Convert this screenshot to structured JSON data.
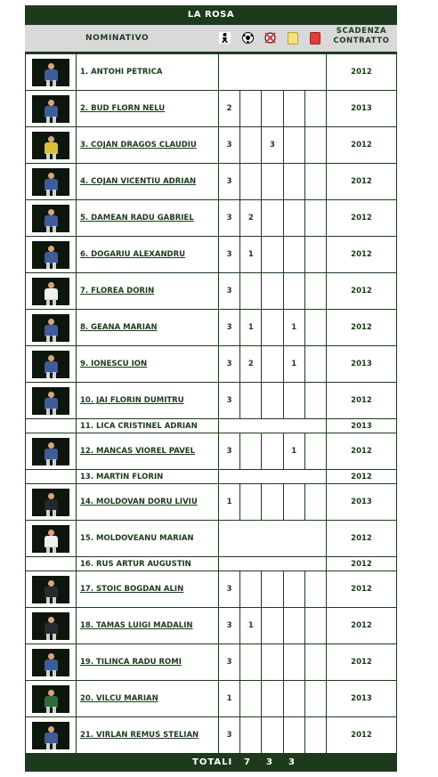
{
  "title": "LA ROSA",
  "header": {
    "nominativo": "NOMINATIVO",
    "scadenza_line1": "SCADENZA",
    "scadenza_line2": "CONTRATTO",
    "icons": [
      "presenze-icon",
      "gol-icon",
      "autogol-icon",
      "yellow-card-icon",
      "red-card-icon"
    ]
  },
  "colors": {
    "dark_green": "#1d3a1d",
    "header_gray": "#d9d9d9",
    "yellow_card": "#f5e27a",
    "red_card": "#e23b3b"
  },
  "players": [
    {
      "name": "1. ANTOHI PETRICA",
      "stats": [
        "",
        "",
        "",
        "",
        ""
      ],
      "year": "2012",
      "photo": true,
      "merged": true,
      "jersey": "#3e5b9a"
    },
    {
      "name": "2. BUD FLORN NELU",
      "stats": [
        "2",
        "",
        "",
        "",
        ""
      ],
      "year": "2013",
      "photo": true,
      "merged": false,
      "jersey": "#3e5b9a"
    },
    {
      "name": "3. COJAN DRAGOS CLAUDIU",
      "stats": [
        "3",
        "",
        "3",
        "",
        ""
      ],
      "year": "2012",
      "photo": true,
      "merged": false,
      "jersey": "#d9c23a"
    },
    {
      "name": "4. COJAN VICENTIU ADRIAN",
      "stats": [
        "3",
        "",
        "",
        "",
        ""
      ],
      "year": "2012",
      "photo": true,
      "merged": false,
      "jersey": "#3e5b9a"
    },
    {
      "name": "5. DAMEAN RADU GABRIEL",
      "stats": [
        "3",
        "2",
        "",
        "",
        ""
      ],
      "year": "2012",
      "photo": true,
      "merged": false,
      "jersey": "#3e5b9a"
    },
    {
      "name": "6. DOGARIU ALEXANDRU",
      "stats": [
        "3",
        "1",
        "",
        "",
        ""
      ],
      "year": "2012",
      "photo": true,
      "merged": false,
      "jersey": "#3e5b9a"
    },
    {
      "name": "7. FLOREA DORIN",
      "stats": [
        "3",
        "",
        "",
        "",
        ""
      ],
      "year": "2012",
      "photo": true,
      "merged": false,
      "jersey": "#f0f0f0"
    },
    {
      "name": "8. GEANA MARIAN",
      "stats": [
        "3",
        "1",
        "",
        "1",
        ""
      ],
      "year": "2012",
      "photo": true,
      "merged": false,
      "jersey": "#3e5b9a"
    },
    {
      "name": "9. IONESCU ION",
      "stats": [
        "3",
        "2",
        "",
        "1",
        ""
      ],
      "year": "2013",
      "photo": true,
      "merged": false,
      "jersey": "#3e5b9a"
    },
    {
      "name": "10. JAI FLORIN DUMITRU",
      "stats": [
        "3",
        "",
        "",
        "",
        ""
      ],
      "year": "2012",
      "photo": true,
      "merged": false,
      "jersey": "#3e5b9a"
    },
    {
      "name": "11. LICA CRISTINEL ADRIAN",
      "stats": [
        "",
        "",
        "",
        "",
        ""
      ],
      "year": "2013",
      "photo": false,
      "merged": true,
      "jersey": ""
    },
    {
      "name": "12. MANCAS VIOREL PAVEL",
      "stats": [
        "3",
        "",
        "",
        "1",
        ""
      ],
      "year": "2012",
      "photo": true,
      "merged": false,
      "jersey": "#3e5b9a"
    },
    {
      "name": "13. MARTIN FLORIN",
      "stats": [
        "",
        "",
        "",
        "",
        ""
      ],
      "year": "2012",
      "photo": false,
      "merged": true,
      "jersey": ""
    },
    {
      "name": "14. MOLDOVAN DORU LIVIU",
      "stats": [
        "1",
        "",
        "",
        "",
        ""
      ],
      "year": "2013",
      "photo": true,
      "merged": false,
      "jersey": "#26262e"
    },
    {
      "name": "15. MOLDOVEANU MARIAN",
      "stats": [
        "",
        "",
        "",
        "",
        ""
      ],
      "year": "2012",
      "photo": true,
      "merged": true,
      "jersey": "#f0f0f0"
    },
    {
      "name": "16. RUS ARTUR AUGUSTIN",
      "stats": [
        "",
        "",
        "",
        "",
        ""
      ],
      "year": "2012",
      "photo": false,
      "merged": true,
      "jersey": ""
    },
    {
      "name": "17. STOIC BOGDAN ALIN",
      "stats": [
        "3",
        "",
        "",
        "",
        ""
      ],
      "year": "2012",
      "photo": true,
      "merged": false,
      "jersey": "#2a2a32"
    },
    {
      "name": "18. TAMAS LUIGI MADALIN",
      "stats": [
        "3",
        "1",
        "",
        "",
        ""
      ],
      "year": "2012",
      "photo": true,
      "merged": false,
      "jersey": "#2a2a32"
    },
    {
      "name": "19. TILINCA RADU ROMI",
      "stats": [
        "3",
        "",
        "",
        "",
        ""
      ],
      "year": "2012",
      "photo": true,
      "merged": false,
      "jersey": "#3e5b9a"
    },
    {
      "name": "20. VILCU MARIAN",
      "stats": [
        "1",
        "",
        "",
        "",
        ""
      ],
      "year": "2013",
      "photo": true,
      "merged": false,
      "jersey": "#2f6a3a"
    },
    {
      "name": "21. VIRLAN REMUS STELIAN",
      "stats": [
        "3",
        "",
        "",
        "",
        ""
      ],
      "year": "2012",
      "photo": true,
      "merged": false,
      "jersey": "#3e5b9a"
    }
  ],
  "totals": {
    "label": "TOTALI",
    "values": [
      "7",
      "3",
      "3"
    ]
  }
}
